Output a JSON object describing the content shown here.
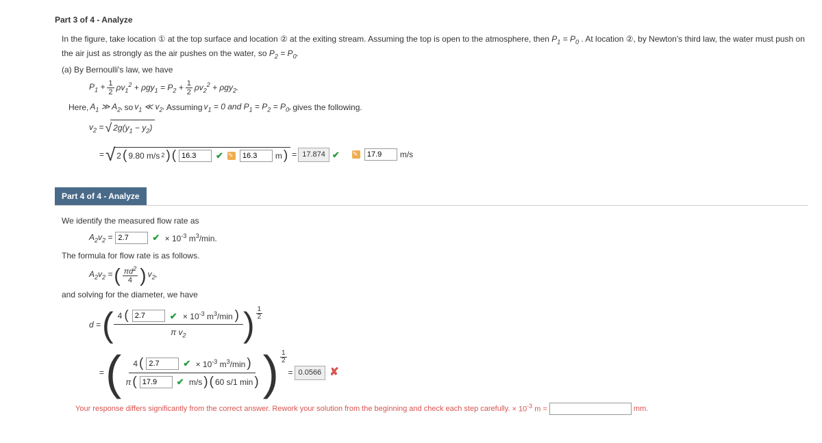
{
  "part3": {
    "header": "Part 3 of 4 - Analyze",
    "text1": "In the figure, take location ① at the top surface and location ② at the exiting stream. Assuming the top is open to the atmosphere, then ",
    "p1eq": "P",
    "text2": ". At location ②, by Newton's third law, the water must push on the air just as strongly as the air pushes on the water, so ",
    "text3": "(a) By Bernoulli's law, we have",
    "text4": "Here,",
    "text5": " so ",
    "text6": " Assuming ",
    "text7": " gives the following.",
    "input1": "16.3",
    "input2": "16.3",
    "boxed1": "17.874",
    "input3": "17.9",
    "unit_m": "m",
    "unit_ms": "m/s",
    "grav": "9.80 m/s"
  },
  "part4": {
    "header": "Part 4 of 4 - Analyze",
    "text1": "We identify the measured flow rate as",
    "input_av": "2.7",
    "unit1": "× 10",
    "unit2": " m",
    "unit3": "/min.",
    "text2": "The formula for flow rate is as follows.",
    "text3": "and solving for the diameter, we have",
    "input_d1": "2.7",
    "unit_min": "/min",
    "input_d2": "2.7",
    "input_v": "17.9",
    "unit_ms": "m/s",
    "paren_conv": "60 s/1 min",
    "boxed_ans": "0.0566",
    "feedback_text": "Your response differs significantly from the correct answer. Rework your solution from the beginning and check each step carefully.",
    "feedback_suffix": " × 10",
    "feedback_eq": " m = ",
    "mm_label": " mm."
  }
}
